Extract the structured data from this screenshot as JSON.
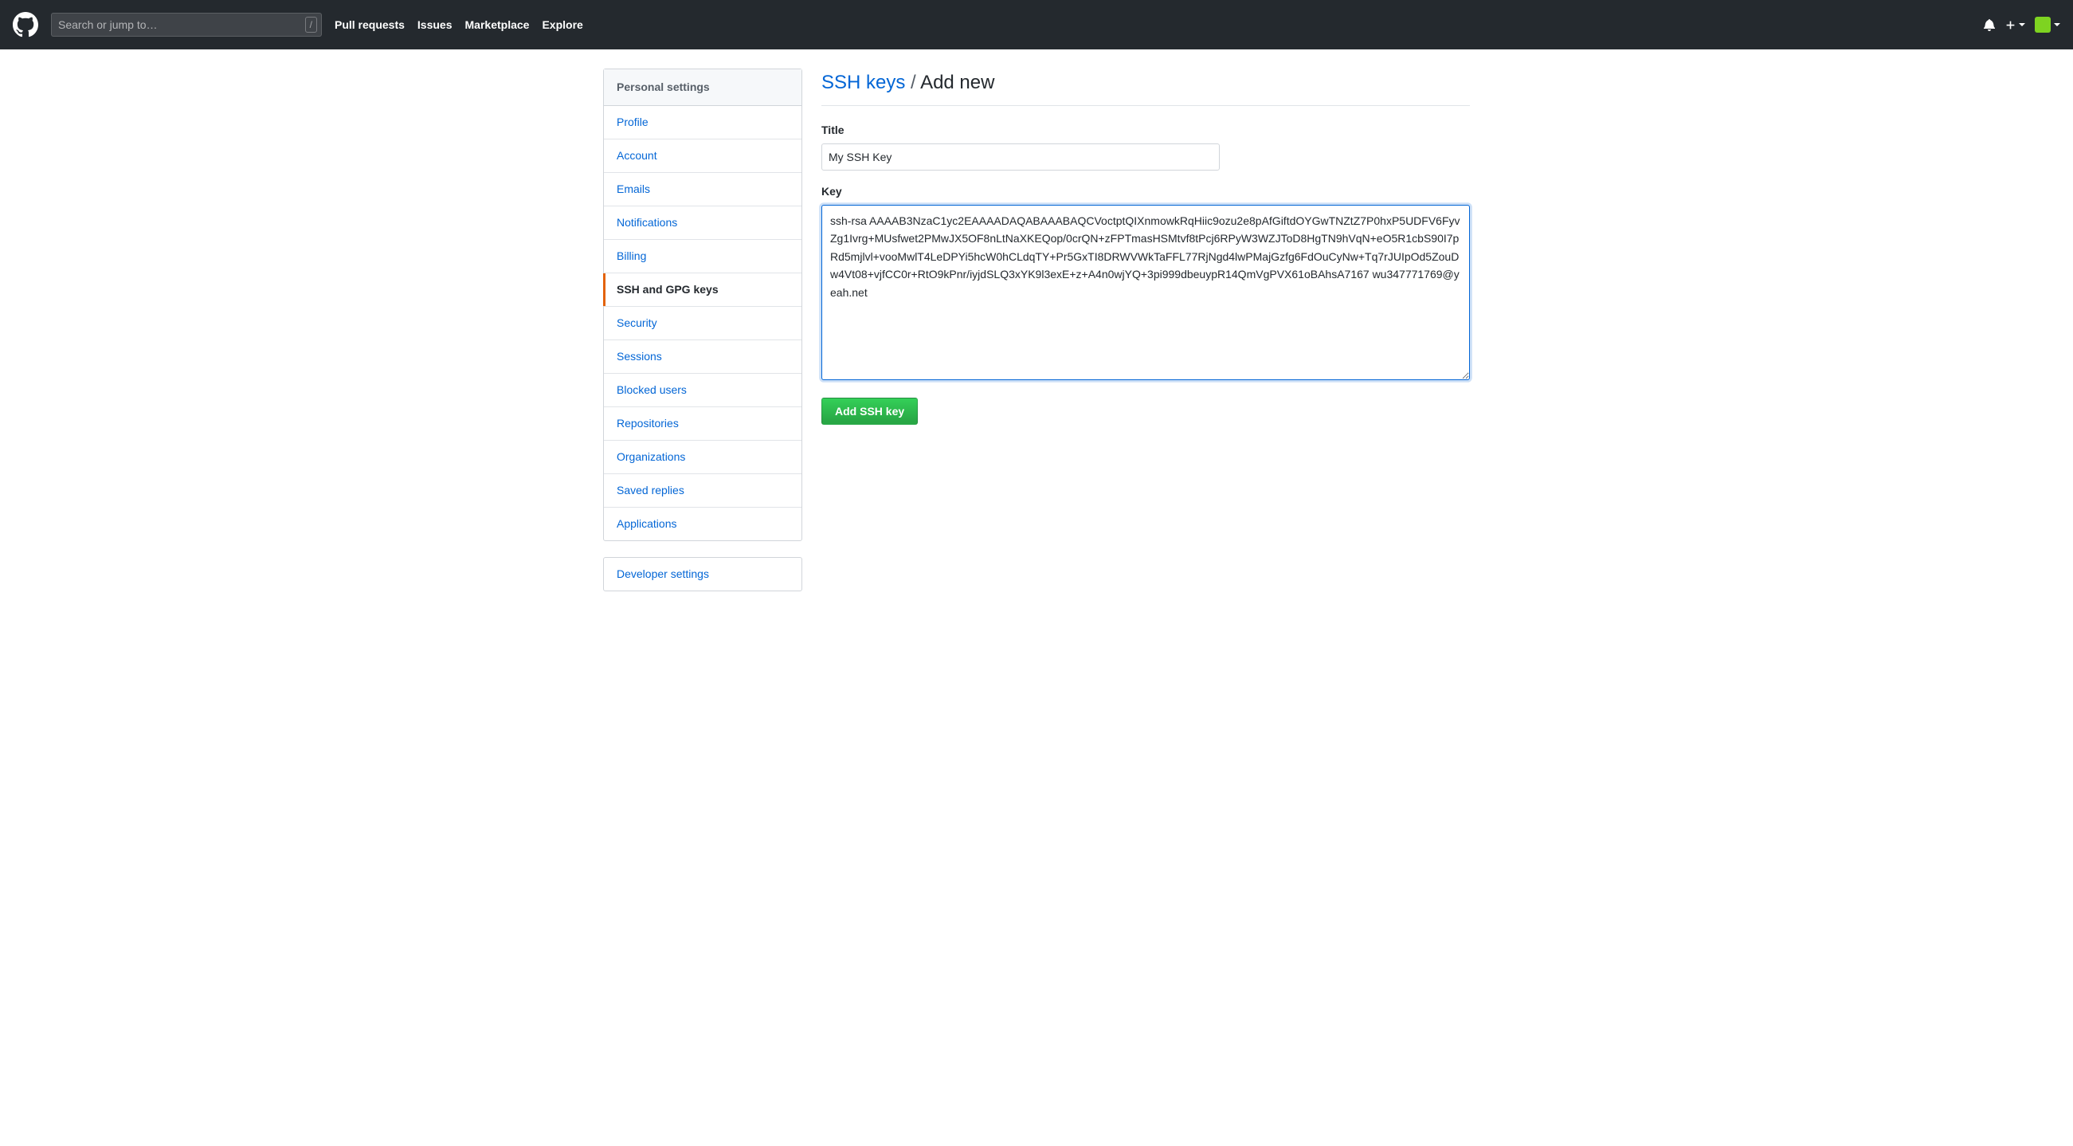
{
  "header": {
    "search_placeholder": "Search or jump to…",
    "nav": {
      "pull_requests": "Pull requests",
      "issues": "Issues",
      "marketplace": "Marketplace",
      "explore": "Explore"
    }
  },
  "sidebar": {
    "title": "Personal settings",
    "items": {
      "profile": "Profile",
      "account": "Account",
      "emails": "Emails",
      "notifications": "Notifications",
      "billing": "Billing",
      "ssh_gpg": "SSH and GPG keys",
      "security": "Security",
      "sessions": "Sessions",
      "blocked_users": "Blocked users",
      "repositories": "Repositories",
      "organizations": "Organizations",
      "saved_replies": "Saved replies",
      "applications": "Applications"
    },
    "developer_settings": "Developer settings"
  },
  "main": {
    "title_link": "SSH keys",
    "title_sep": "/",
    "title_tail": "Add new",
    "form": {
      "title_label": "Title",
      "title_value": "My SSH Key",
      "key_label": "Key",
      "key_value": "ssh-rsa AAAAB3NzaC1yc2EAAAADAQABAAABAQCVoctptQIXnmowkRqHiic9ozu2e8pAfGiftdOYGwTNZtZ7P0hxP5UDFV6FyvZg1Ivrg+MUsfwet2PMwJX5OF8nLtNaXKEQop/0crQN+zFPTmasHSMtvf8tPcj6RPyW3WZJToD8HgTN9hVqN+eO5R1cbS90I7pRd5mjlvl+vooMwlT4LeDPYi5hcW0hCLdqTY+Pr5GxTI8DRWVWkTaFFL77RjNgd4lwPMajGzfg6FdOuCyNw+Tq7rJUIpOd5ZouDw4Vt08+vjfCC0r+RtO9kPnr/iyjdSLQ3xYK9l3exE+z+A4n0wjYQ+3pi999dbeuypR14QmVgPVX61oBAhsA7167 wu347771769@yeah.net",
      "submit_label": "Add SSH key"
    }
  }
}
